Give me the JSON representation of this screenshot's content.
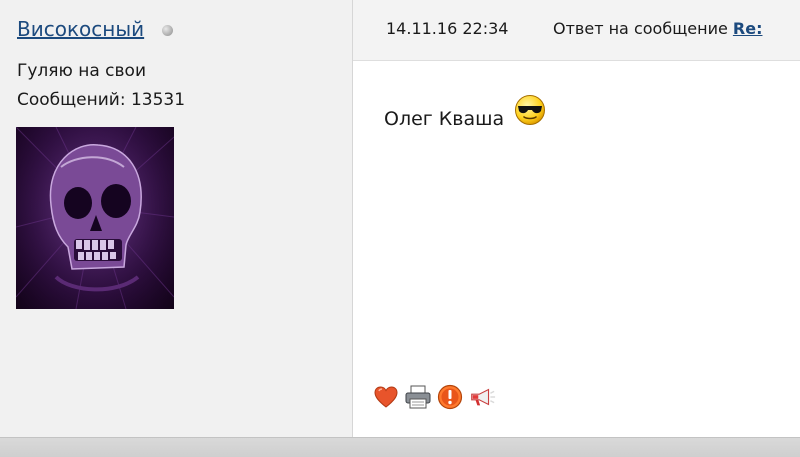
{
  "user": {
    "username": "Високосный",
    "title": "Гуляю на свои",
    "posts_label": "Сообщений: 13531",
    "status_icon": "offline-dot-icon"
  },
  "message": {
    "date": "14.11.16 22:34",
    "reply_label": "Ответ на сообщение",
    "reply_link": "Re:",
    "text": "Олег Кваша",
    "smiley": "sunglasses-smiley-icon"
  },
  "actions": [
    "heart-icon",
    "printer-icon",
    "alert-icon",
    "megaphone-icon"
  ],
  "colors": {
    "link": "#1c4a7e",
    "user_panel_bg": "#f1f1f1",
    "header_bg": "#f3f3f3",
    "footer_bg": "#d9d9d9"
  }
}
